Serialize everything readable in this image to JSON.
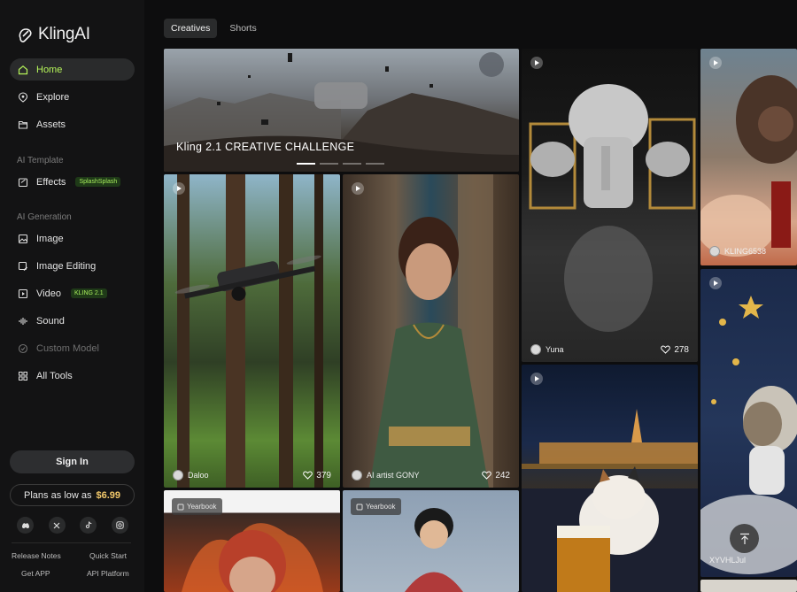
{
  "brand": {
    "name": "KlingAI"
  },
  "nav": {
    "items": [
      {
        "label": "Home",
        "icon": "home-icon"
      },
      {
        "label": "Explore",
        "icon": "compass-icon"
      },
      {
        "label": "Assets",
        "icon": "folder-icon"
      }
    ],
    "template_section": "AI Template",
    "effects": {
      "label": "Effects",
      "badge": "SplashSplash"
    },
    "generation_section": "AI Generation",
    "gen_items": [
      {
        "label": "Image",
        "icon": "image-icon"
      },
      {
        "label": "Image Editing",
        "icon": "image-edit-icon"
      },
      {
        "label": "Video",
        "icon": "video-icon",
        "badge": "KLING 2.1"
      },
      {
        "label": "Sound",
        "icon": "sound-icon"
      },
      {
        "label": "Custom Model",
        "icon": "custom-model-icon"
      },
      {
        "label": "All Tools",
        "icon": "grid-icon"
      }
    ]
  },
  "sidebar_footer": {
    "signin": "Sign In",
    "plans_label": "Plans as low as",
    "plans_price": "$6.99",
    "socials": [
      "discord-icon",
      "x-icon",
      "tiktok-icon",
      "instagram-icon"
    ],
    "links": [
      "Release Notes",
      "Quick Start",
      "Get APP",
      "API Platform"
    ]
  },
  "tabs": [
    "Creatives",
    "Shorts"
  ],
  "banner": {
    "title": "Kling 2.1 CREATIVE CHALLENGE"
  },
  "cards": {
    "drone": {
      "user": "Daloo",
      "likes": "379"
    },
    "woman": {
      "user": "AI artist GONY",
      "likes": "242"
    },
    "elephant": {
      "user": "Yuna",
      "likes": "278"
    },
    "samurai": {
      "user": "KLING6538"
    },
    "hedgehog": {
      "user": "XYVHLJul"
    },
    "yearbook1": {
      "tag": "Yearbook"
    },
    "yearbook2": {
      "tag": "Yearbook"
    }
  },
  "colors": {
    "accent": "#b6f55a",
    "price": "#f3c96b",
    "bg": "#0d0d0e"
  }
}
